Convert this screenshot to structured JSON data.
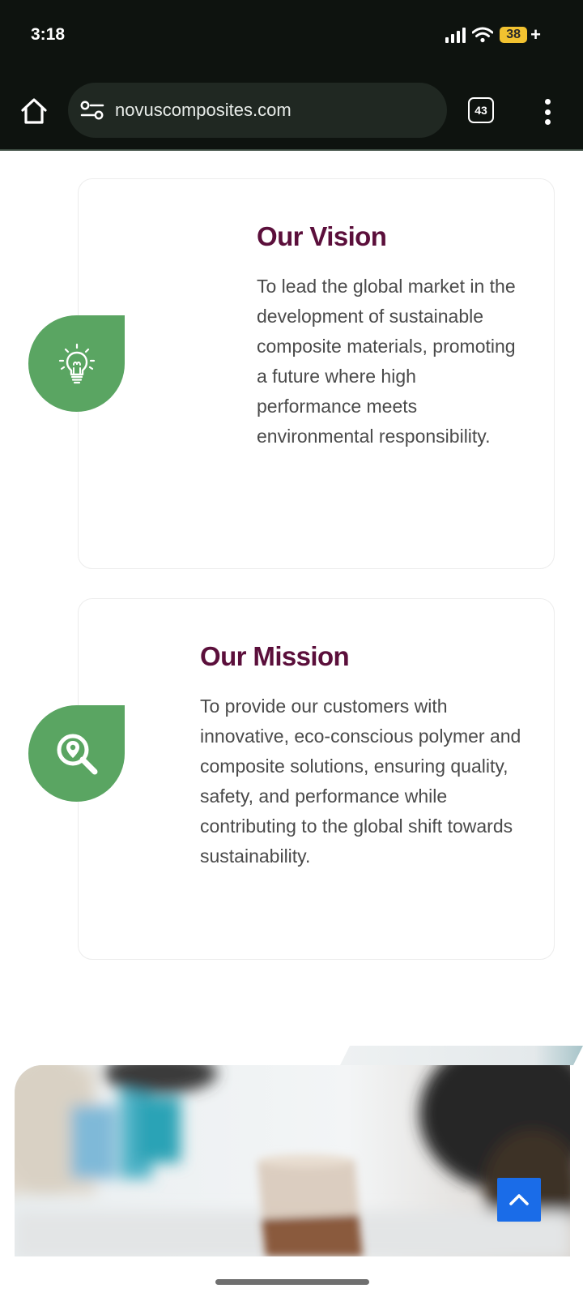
{
  "status_bar": {
    "time": "3:18",
    "battery_level": "38",
    "battery_suffix": "+",
    "icons": [
      "signal-icon",
      "wifi-icon",
      "battery-icon"
    ]
  },
  "browser": {
    "url": "novuscomposites.com",
    "tab_count": "43",
    "icons": [
      "home-icon",
      "site-settings-icon",
      "tabs-icon",
      "more-menu-icon"
    ]
  },
  "vision": {
    "title": "Our Vision",
    "text": "To lead the global market in the development of sustainable composite materials, promoting a future where high performance meets environmental responsibility.",
    "icon": "lightbulb-icon"
  },
  "mission": {
    "title": "Our Mission",
    "text": "To provide our customers with innovative, eco-conscious polymer and composite solutions, ensuring quality, safety, and performance while contributing to the global shift towards sustainability.",
    "icon": "location-search-icon"
  },
  "photo": {
    "subject": "blurred laboratory scene with beakers"
  },
  "scroll_top": {
    "icon": "chevron-up-icon"
  },
  "colors": {
    "heading": "#5b0f3b",
    "body_text": "#4a4a4a",
    "badge_green": "#5aa562",
    "scroll_top_blue": "#1a6ce8",
    "browser_bar": "#0e130f",
    "battery_yellow": "#f2c230"
  }
}
